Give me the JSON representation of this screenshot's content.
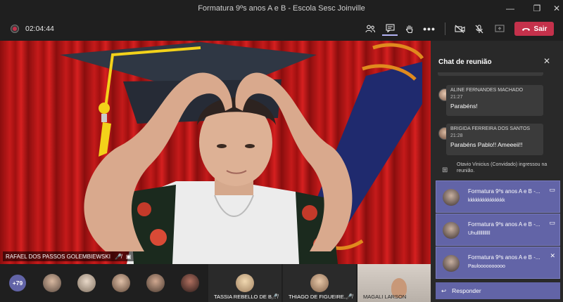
{
  "window": {
    "title": "Formatura 9ºs anos A e B - Escola Sesc Joinville",
    "minimize_icon": "minimize-icon",
    "restore_icon": "restore-icon",
    "close_icon": "close-icon"
  },
  "toolbar": {
    "timer": "02:04:44",
    "leave_label": "Sair",
    "colors": {
      "leave": "#c4314b",
      "accent": "#6264a7"
    }
  },
  "stage": {
    "speaker_name": "RAFAEL DOS PASSOS GOLEMBIEWSKI"
  },
  "strip": {
    "more_count": "+79",
    "tiles": [
      {
        "name": "TASSIA REBELLO DE B..."
      },
      {
        "name": "THIAGO DE FIGUEIRE..."
      },
      {
        "name": "MAGALI LARSON"
      }
    ]
  },
  "chat": {
    "title": "Chat de reunião",
    "messages": [
      {
        "sender": "ALINE FERNANDES MACHADO",
        "time": "21:27",
        "text": "Parabéns!"
      },
      {
        "sender": "BRIGIDA FERREIRA DOS SANTOS",
        "time": "21:28",
        "text": "Parabéns Pablo!! Ameeeii!!"
      }
    ],
    "system": {
      "text": "Otavio Vinicius (Convidado) ingressou na reunião."
    },
    "notifications": [
      {
        "title": "Formatura 9ºs anos A e B -...",
        "text": "kkkkkkkkkkkkkkk"
      },
      {
        "title": "Formatura 9ºs anos A e B -...",
        "text": "Uhullllllllllll"
      },
      {
        "title": "Formatura 9ºs anos A e B -...",
        "text": "Pauloooooooooo"
      }
    ],
    "reply_label": "Responder"
  }
}
